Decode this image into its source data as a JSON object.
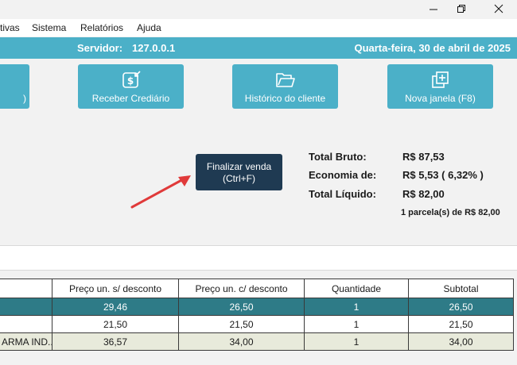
{
  "window": {
    "buttons": [
      "minimize",
      "maximize",
      "close"
    ]
  },
  "menu": {
    "items": [
      "tivas",
      "Sistema",
      "Relatórios",
      "Ajuda"
    ]
  },
  "status": {
    "server_label": "Servidor:",
    "server_value": "127.0.0.1",
    "date": "Quarta-feira, 30 de abril de 2025"
  },
  "toolbar": {
    "partial_label": ")",
    "receber_label": "Receber Crediário",
    "historico_label": "Histórico do cliente",
    "nova_janela_label": "Nova janela (F8)"
  },
  "finalize": {
    "line1": "Finalizar venda",
    "line2": "(Ctrl+F)"
  },
  "totals": {
    "bruto_label": "Total Bruto:",
    "bruto_value": "R$ 87,53",
    "economia_label": "Economia de:",
    "economia_value": "R$ 5,53 ( 6,32% )",
    "liquido_label": "Total Líquido:",
    "liquido_value": "R$ 82,00",
    "installments": "1 parcela(s) de R$ 82,00"
  },
  "table": {
    "headers": [
      "",
      "Preço un. s/ desconto",
      "Preço un. c/ desconto",
      "Quantidade",
      "Subtotal"
    ],
    "rows": [
      [
        "",
        "29,46",
        "26,50",
        "1",
        "26,50"
      ],
      [
        "",
        "21,50",
        "21,50",
        "1",
        "21,50"
      ],
      [
        "ARMA IND...",
        "36,57",
        "34,00",
        "1",
        "34,00"
      ]
    ]
  },
  "colors": {
    "accent": "#4bb0c8",
    "finalize": "#1f3a52",
    "selected_row": "#2e7b87",
    "arrow": "#e03a3a"
  }
}
